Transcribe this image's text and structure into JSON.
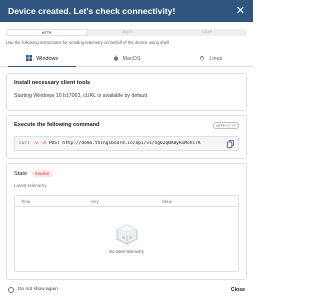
{
  "dialog": {
    "title": "Device created. Let's check connectivity!",
    "close_icon": "close-icon"
  },
  "protocols": {
    "options": [
      "HTTP",
      "MQTT",
      "COAP"
    ],
    "selected": "HTTP"
  },
  "hint": "Use the following instructions for sending telemetry on behalf of the device using shell",
  "os_tabs": [
    {
      "label": "Windows",
      "icon": "windows-icon",
      "active": true
    },
    {
      "label": "MacOS",
      "icon": "apple-icon",
      "active": false
    },
    {
      "label": "Linux",
      "icon": "linux-icon",
      "active": false
    }
  ],
  "install": {
    "title": "Install necessary client tools",
    "text": "Starting Windows 10 b17063, cURL is available by default"
  },
  "command": {
    "title": "Execute the following command",
    "toggle_left": "HTTP",
    "toggle_right": "HTTPS",
    "code_curl": "curl",
    "code_flag1": "-v",
    "code_flag2": "-X",
    "code_rest": "POST http://demo.thingsboard.io/api/v1/SgU2qNAByRxMohs7K"
  },
  "state": {
    "label": "State",
    "badge": "Inactive",
    "latest_label": "Latest telemetry",
    "columns": [
      "Time",
      "Key",
      "Value"
    ],
    "empty_text": "No latest telemetry"
  },
  "footer": {
    "checkbox_label": "Do not show again",
    "close_button": "Close"
  },
  "colors": {
    "header": "#305680",
    "inactive": "#d32f2f"
  }
}
